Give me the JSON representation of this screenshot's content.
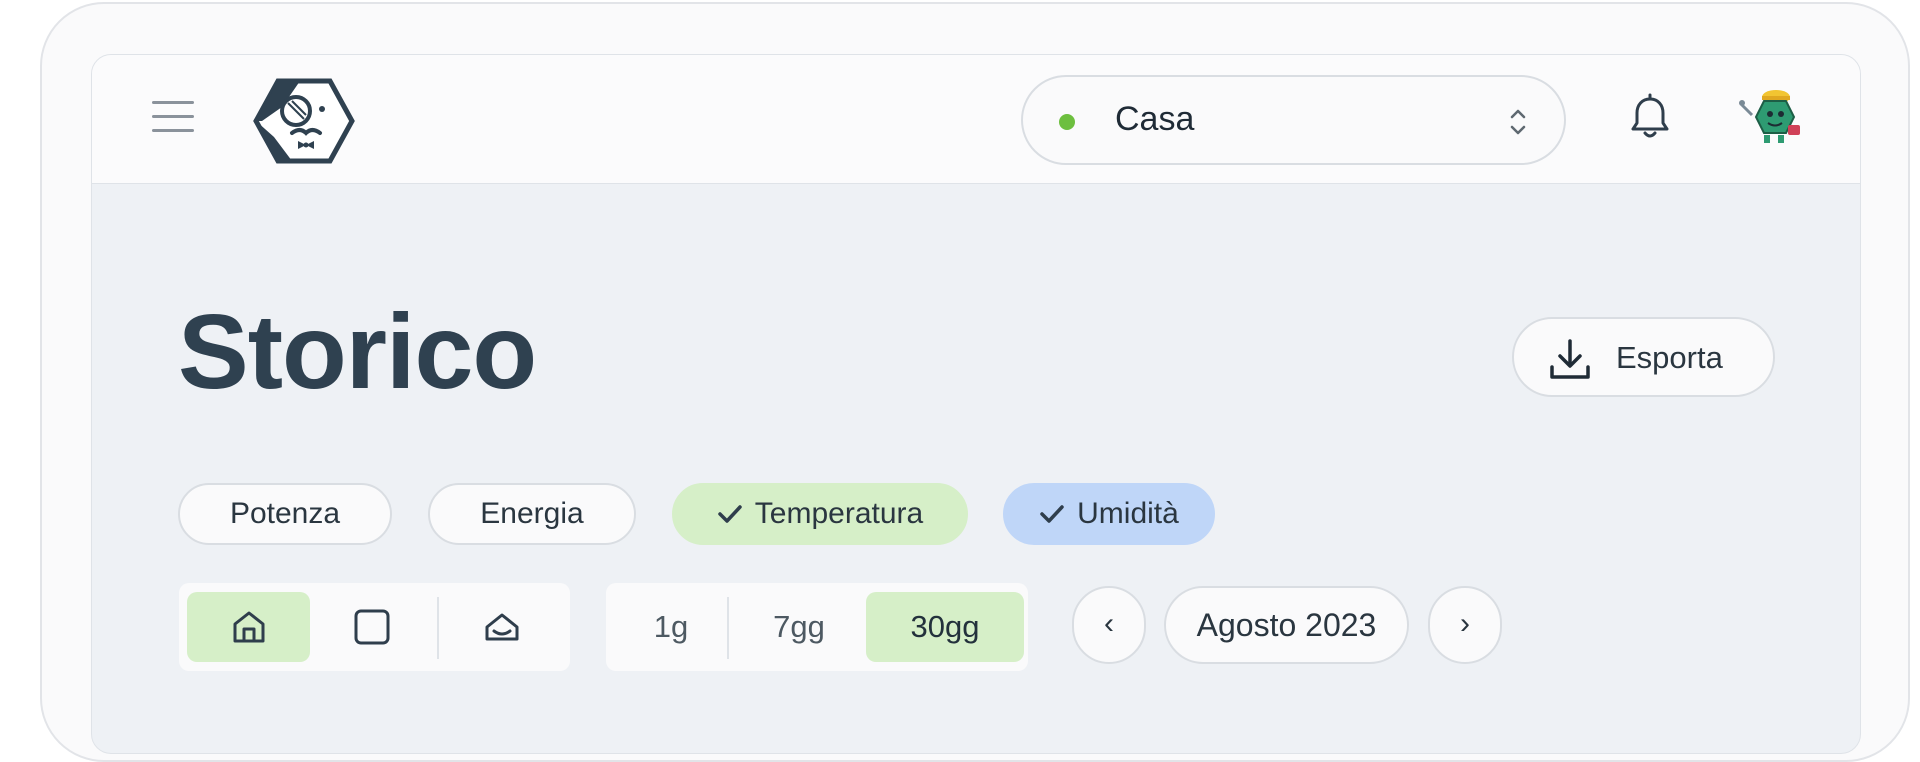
{
  "header": {
    "home_selector": {
      "label": "Casa",
      "status_color": "#6dbf3f"
    },
    "icons": {
      "menu": "hamburger-icon",
      "notifications": "bell-icon",
      "avatar": "robot-avatar"
    }
  },
  "page": {
    "title": "Storico",
    "export_label": "Esporta"
  },
  "metric_chips": [
    {
      "label": "Potenza",
      "selected": false
    },
    {
      "label": "Energia",
      "selected": false
    },
    {
      "label": "Temperatura",
      "selected": true,
      "color": "#d6efc8"
    },
    {
      "label": "Umidità",
      "selected": true,
      "color": "#bfd6f8"
    }
  ],
  "scope_segment": {
    "options": [
      "home-icon",
      "square-icon",
      "outdoor-icon"
    ],
    "selected_index": 0
  },
  "range_segment": {
    "options": [
      "1g",
      "7gg",
      "30gg"
    ],
    "selected_index": 2
  },
  "period": {
    "prev": "‹",
    "label": "Agosto 2023",
    "next": "›"
  },
  "colors": {
    "accent_green": "#d6efc8",
    "accent_blue": "#bfd6f8",
    "title": "#2f4150"
  }
}
